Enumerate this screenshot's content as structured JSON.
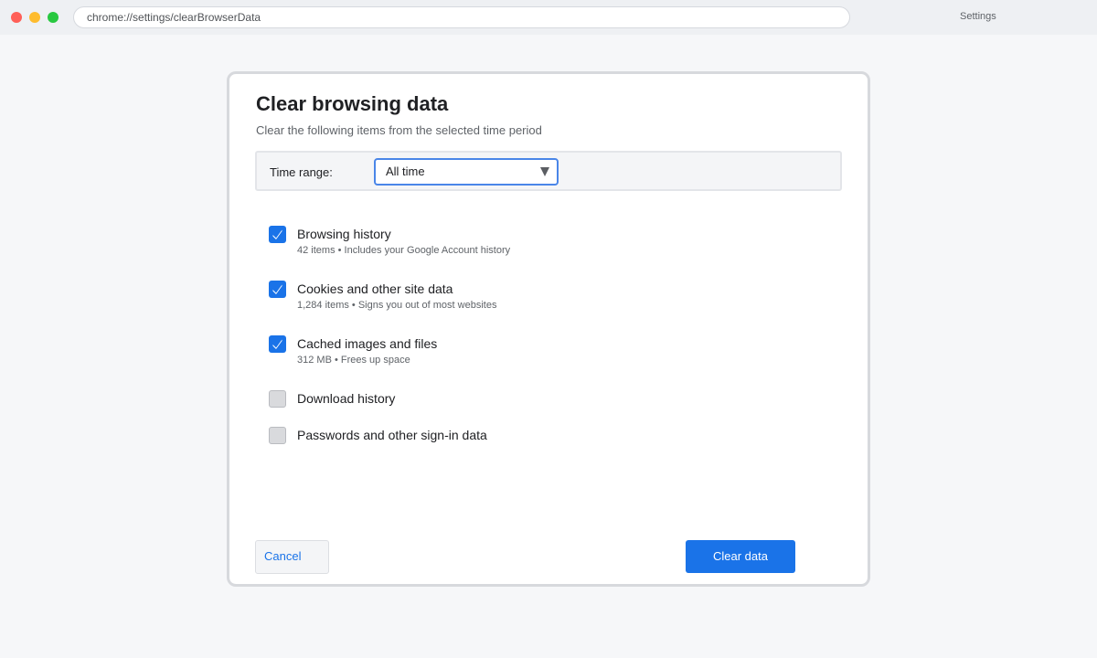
{
  "browser": {
    "url": "chrome://settings/clearBrowserData",
    "tab_title": "Settings"
  },
  "dialog": {
    "title": "Clear browsing data",
    "subtitle": "Clear the following items from the selected time period",
    "time_range": {
      "label": "Time range:",
      "selected": "All time"
    },
    "items": [
      {
        "label": "Browsing history",
        "detail": "42 items • Includes your Google Account history",
        "checked": true
      },
      {
        "label": "Cookies and other site data",
        "detail": "1,284 items • Signs you out of most websites",
        "checked": true
      },
      {
        "label": "Cached images and files",
        "detail": "312 MB • Frees up space",
        "checked": true
      },
      {
        "label": "Download history",
        "detail": "",
        "checked": false
      },
      {
        "label": "Passwords and other sign-in data",
        "detail": "",
        "checked": false
      }
    ],
    "cancel_label": "Cancel",
    "clear_label": "Clear data"
  },
  "colors": {
    "accent": "#1a73e8",
    "background": "#f6f7f9"
  }
}
